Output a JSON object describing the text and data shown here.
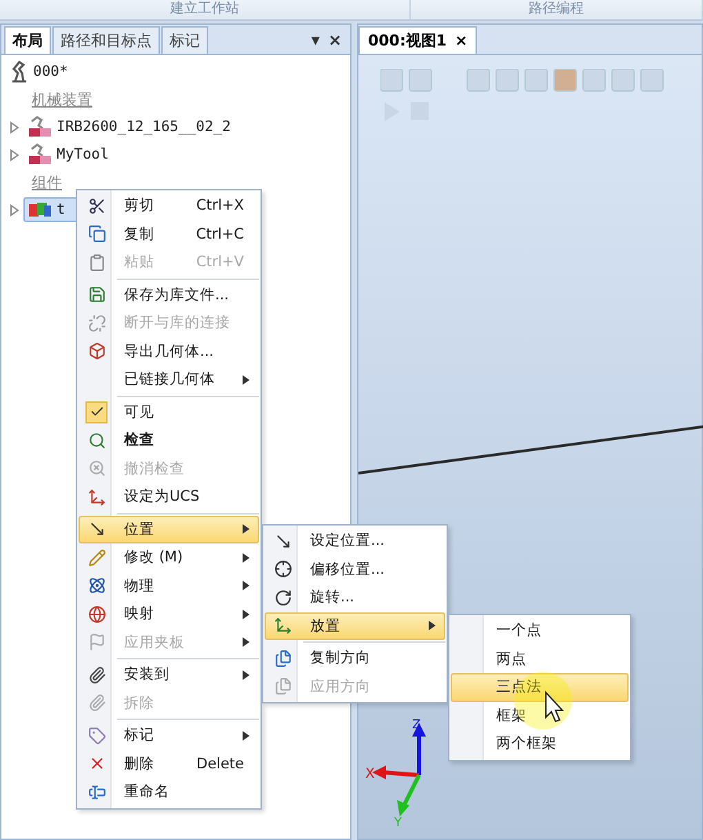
{
  "ribbon": {
    "groups": [
      "建立工作站",
      "路径编程"
    ]
  },
  "layout_panel": {
    "tabs": [
      {
        "label": "布局",
        "selected": true
      },
      {
        "label": "路径和目标点",
        "selected": false
      },
      {
        "label": "标记",
        "selected": false
      }
    ],
    "controls": [
      "▾",
      "×"
    ],
    "tree": [
      {
        "kind": "root",
        "label": "000*"
      },
      {
        "kind": "section",
        "label": "机械装置"
      },
      {
        "kind": "robot",
        "label": "IRB2600_12_165__02_2",
        "selected": false
      },
      {
        "kind": "tool",
        "label": "MyTool",
        "selected": false
      },
      {
        "kind": "section",
        "label": "组件"
      },
      {
        "kind": "part",
        "label": "t",
        "selected": true
      }
    ]
  },
  "view": {
    "tab": {
      "label": "000:视图1",
      "close": "×"
    },
    "axes": [
      "X",
      "Y",
      "Z"
    ]
  },
  "context_menu": [
    {
      "kind": "item",
      "label": "剪切",
      "shortcut": "Ctrl+X",
      "disabled": false,
      "submenu": false,
      "selected": false,
      "bold": false
    },
    {
      "kind": "item",
      "label": "复制",
      "shortcut": "Ctrl+C",
      "disabled": false,
      "submenu": false,
      "selected": false,
      "bold": false
    },
    {
      "kind": "item",
      "label": "粘贴",
      "shortcut": "Ctrl+V",
      "disabled": true,
      "submenu": false,
      "selected": false,
      "bold": false
    },
    {
      "kind": "separator"
    },
    {
      "kind": "item",
      "label": "保存为库文件...",
      "disabled": false,
      "submenu": false,
      "selected": false,
      "bold": false
    },
    {
      "kind": "item",
      "label": "断开与库的连接",
      "disabled": true,
      "submenu": false,
      "selected": false,
      "bold": false
    },
    {
      "kind": "item",
      "label": "导出几何体...",
      "disabled": false,
      "submenu": false,
      "selected": false,
      "bold": false
    },
    {
      "kind": "item",
      "label": "已链接几何体",
      "disabled": false,
      "submenu": true,
      "selected": false,
      "bold": false
    },
    {
      "kind": "separator"
    },
    {
      "kind": "check",
      "label": "可见",
      "checked": true,
      "disabled": false,
      "submenu": false,
      "selected": false,
      "bold": false
    },
    {
      "kind": "item",
      "label": "检查",
      "disabled": false,
      "submenu": false,
      "selected": false,
      "bold": true
    },
    {
      "kind": "item",
      "label": "撤消检查",
      "disabled": true,
      "submenu": false,
      "selected": false,
      "bold": false
    },
    {
      "kind": "item",
      "label": "设定为UCS",
      "disabled": false,
      "submenu": false,
      "selected": false,
      "bold": false
    },
    {
      "kind": "separator"
    },
    {
      "kind": "item",
      "label": "位置",
      "disabled": false,
      "submenu": true,
      "selected": true,
      "bold": false
    },
    {
      "kind": "item",
      "label": "修改 (M)",
      "disabled": false,
      "submenu": true,
      "selected": false,
      "bold": false
    },
    {
      "kind": "item",
      "label": "物理",
      "disabled": false,
      "submenu": true,
      "selected": false,
      "bold": false
    },
    {
      "kind": "item",
      "label": "映射",
      "disabled": false,
      "submenu": true,
      "selected": false,
      "bold": false
    },
    {
      "kind": "item",
      "label": "应用夹板",
      "disabled": true,
      "submenu": true,
      "selected": false,
      "bold": false
    },
    {
      "kind": "separator"
    },
    {
      "kind": "item",
      "label": "安装到",
      "disabled": false,
      "submenu": true,
      "selected": false,
      "bold": false
    },
    {
      "kind": "item",
      "label": "拆除",
      "disabled": true,
      "submenu": false,
      "selected": false,
      "bold": false
    },
    {
      "kind": "separator"
    },
    {
      "kind": "item",
      "label": "标记",
      "disabled": false,
      "submenu": true,
      "selected": false,
      "bold": false
    },
    {
      "kind": "item",
      "label": "删除",
      "shortcut": "Delete",
      "disabled": false,
      "submenu": false,
      "selected": false,
      "bold": false
    },
    {
      "kind": "item",
      "label": "重命名",
      "disabled": false,
      "submenu": false,
      "selected": false,
      "bold": false
    }
  ],
  "position_menu": [
    {
      "kind": "item",
      "label": "设定位置...",
      "disabled": false,
      "submenu": false,
      "selected": false,
      "bold": false
    },
    {
      "kind": "item",
      "label": "偏移位置...",
      "disabled": false,
      "submenu": false,
      "selected": false,
      "bold": false
    },
    {
      "kind": "item",
      "label": "旋转...",
      "disabled": false,
      "submenu": false,
      "selected": false,
      "bold": false
    },
    {
      "kind": "item",
      "label": "放置",
      "disabled": false,
      "submenu": true,
      "selected": true,
      "bold": false
    },
    {
      "kind": "separator"
    },
    {
      "kind": "item",
      "label": "复制方向",
      "disabled": false,
      "submenu": false,
      "selected": false,
      "bold": false
    },
    {
      "kind": "item",
      "label": "应用方向",
      "disabled": true,
      "submenu": false,
      "selected": false,
      "bold": false
    }
  ],
  "place_menu": [
    {
      "kind": "item",
      "label": "一个点",
      "disabled": false,
      "submenu": false,
      "selected": false,
      "bold": false
    },
    {
      "kind": "item",
      "label": "两点",
      "disabled": false,
      "submenu": false,
      "selected": false,
      "bold": false
    },
    {
      "kind": "item",
      "label": "三点法",
      "disabled": false,
      "submenu": false,
      "selected": true,
      "bold": false
    },
    {
      "kind": "item",
      "label": "框架",
      "disabled": false,
      "submenu": false,
      "selected": false,
      "bold": false
    },
    {
      "kind": "item",
      "label": "两个框架",
      "disabled": false,
      "submenu": false,
      "selected": false,
      "bold": false
    }
  ]
}
